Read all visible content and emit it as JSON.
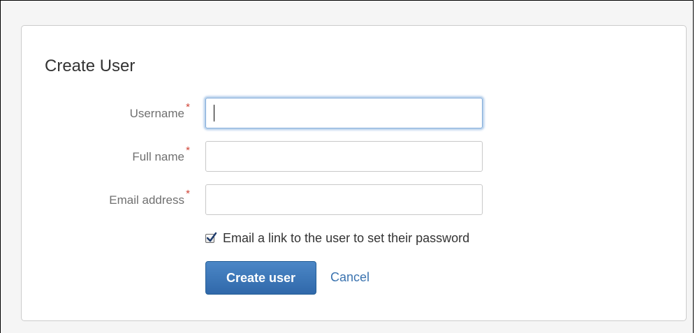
{
  "form": {
    "title": "Create User",
    "required_marker": "*",
    "fields": [
      {
        "label": "Username",
        "value": "",
        "focused": true
      },
      {
        "label": "Full name",
        "value": "",
        "focused": false
      },
      {
        "label": "Email address",
        "value": "",
        "focused": false
      }
    ],
    "email_link_checkbox": {
      "label": "Email a link to the user to set their password",
      "checked": true
    },
    "submit_label": "Create user",
    "cancel_label": "Cancel"
  },
  "colors": {
    "required": "#d04437",
    "primary_button": "#3572b0",
    "link": "#3b73af",
    "label": "#707070",
    "focus_ring": "#a7c4e6"
  }
}
